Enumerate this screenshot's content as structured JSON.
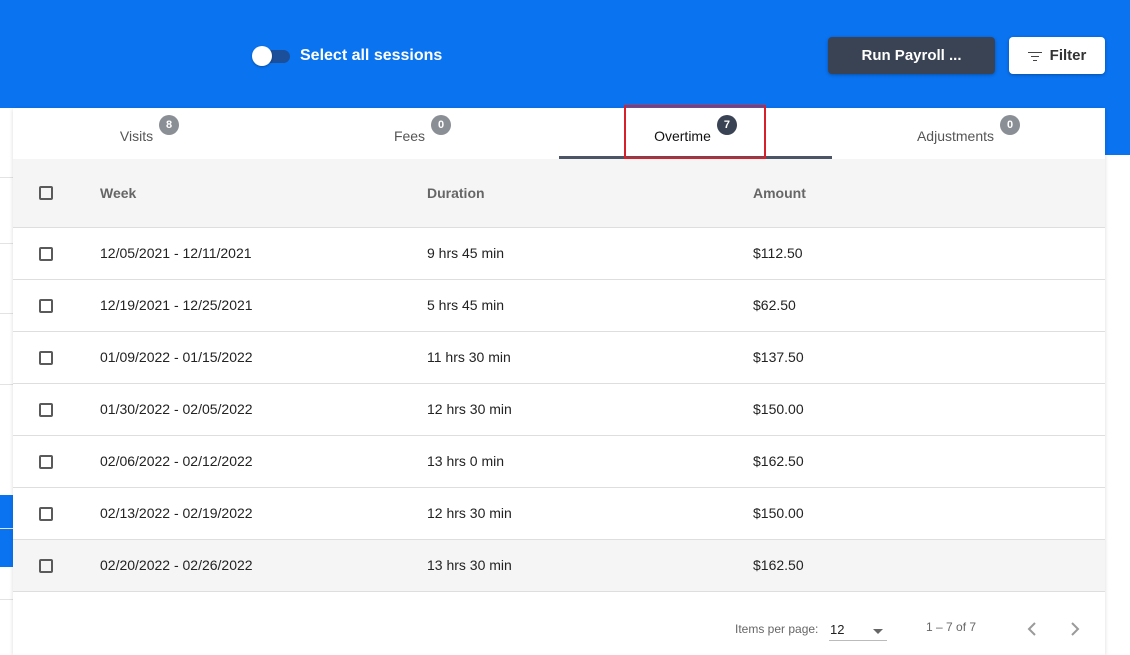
{
  "header": {
    "toggle_label": "Select all sessions",
    "run_payroll_label": "Run Payroll ...",
    "filter_label": "Filter"
  },
  "tabs": [
    {
      "label": "Visits",
      "count": "8"
    },
    {
      "label": "Fees",
      "count": "0"
    },
    {
      "label": "Overtime",
      "count": "7"
    },
    {
      "label": "Adjustments",
      "count": "0"
    }
  ],
  "active_tab": "Overtime",
  "table": {
    "columns": [
      "Week",
      "Duration",
      "Amount"
    ],
    "rows": [
      {
        "week": "12/05/2021 - 12/11/2021",
        "duration": "9 hrs 45 min",
        "amount": "$112.50"
      },
      {
        "week": "12/19/2021 - 12/25/2021",
        "duration": "5 hrs 45 min",
        "amount": "$62.50"
      },
      {
        "week": "01/09/2022 - 01/15/2022",
        "duration": "11 hrs 30 min",
        "amount": "$137.50"
      },
      {
        "week": "01/30/2022 - 02/05/2022",
        "duration": "12 hrs 30 min",
        "amount": "$150.00"
      },
      {
        "week": "02/06/2022 - 02/12/2022",
        "duration": "13 hrs 0 min",
        "amount": "$162.50"
      },
      {
        "week": "02/13/2022 - 02/19/2022",
        "duration": "12 hrs 30 min",
        "amount": "$150.00"
      },
      {
        "week": "02/20/2022 - 02/26/2022",
        "duration": "13 hrs 30 min",
        "amount": "$162.50"
      }
    ]
  },
  "paginator": {
    "items_per_page_label": "Items per page:",
    "items_per_page_value": "12",
    "range_label": "1 – 7 of 7"
  },
  "colors": {
    "brand_blue": "#0a73f0",
    "dark_button": "#3a4354",
    "highlight_red": "#d8202b"
  }
}
